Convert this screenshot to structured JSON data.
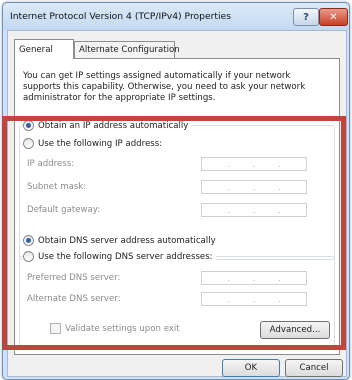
{
  "window": {
    "title": "Internet Protocol Version 4 (TCP/IPv4) Properties",
    "help_glyph": "?",
    "close_glyph": "✕"
  },
  "tabs": [
    {
      "label": "General",
      "active": true
    },
    {
      "label": "Alternate Configuration",
      "active": false
    }
  ],
  "description": "You can get IP settings assigned automatically if your network supports this capability. Otherwise, you need to ask your network administrator for the appropriate IP settings.",
  "ip_section": {
    "auto_label": "Obtain an IP address automatically",
    "manual_label": "Use the following IP address:",
    "selected": "auto",
    "fields": [
      {
        "label": "IP address:"
      },
      {
        "label": "Subnet mask:"
      },
      {
        "label": "Default gateway:"
      }
    ]
  },
  "dns_section": {
    "auto_label": "Obtain DNS server address automatically",
    "manual_label": "Use the following DNS server addresses:",
    "selected": "auto",
    "fields": [
      {
        "label": "Preferred DNS server:"
      },
      {
        "label": "Alternate DNS server:"
      }
    ]
  },
  "ip_dot": ".",
  "validate_label": "Validate settings upon exit",
  "buttons": {
    "advanced": "Advanced...",
    "ok": "OK",
    "cancel": "Cancel"
  },
  "colors": {
    "highlight_border": "#c1443e",
    "window_frame": "#cfe1f4",
    "close_button": "#c64026"
  }
}
